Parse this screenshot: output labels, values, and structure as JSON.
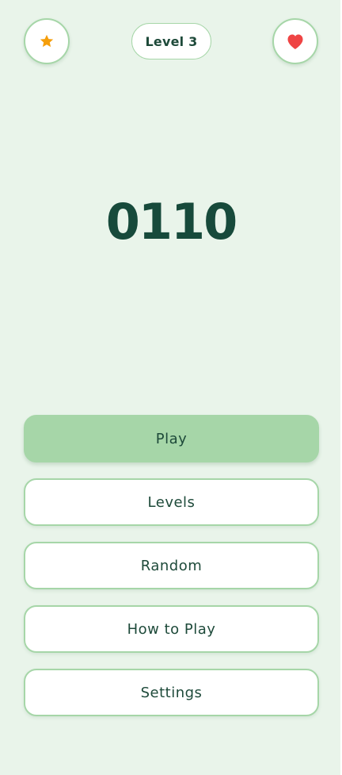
{
  "header": {
    "favorite_icon": "star-icon",
    "favorite_icon_color": "#f59e0b",
    "level_label": "Level 3",
    "lives_icon": "heart-icon",
    "lives_icon_color": "#ef4444"
  },
  "logo": {
    "text": "0110"
  },
  "menu": {
    "items": [
      {
        "label": "Play"
      },
      {
        "label": "Levels"
      },
      {
        "label": "Random"
      },
      {
        "label": "How to Play"
      },
      {
        "label": "Settings"
      }
    ]
  },
  "colors": {
    "background": "#e9f4ea",
    "accent": "#a6d6a8",
    "text": "#1e4a3a"
  }
}
